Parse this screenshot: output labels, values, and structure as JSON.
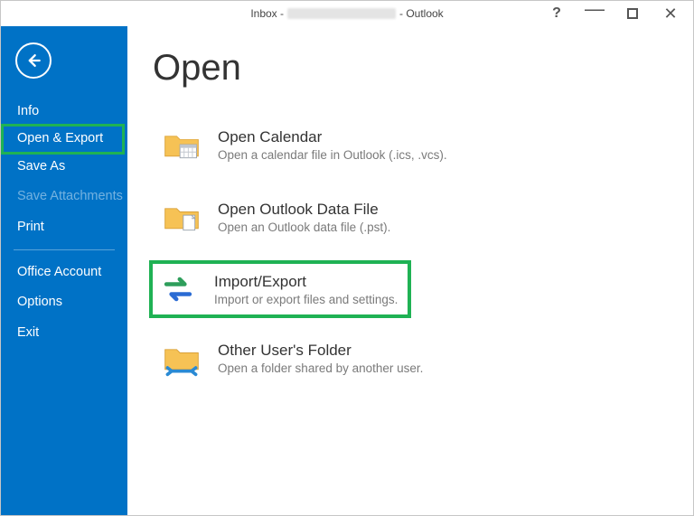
{
  "titlebar": {
    "prefix": "Inbox -",
    "suffix": "- Outlook"
  },
  "sidebar": {
    "items": [
      {
        "label": "Info"
      },
      {
        "label": "Open & Export"
      },
      {
        "label": "Save As"
      },
      {
        "label": "Save Attachments"
      },
      {
        "label": "Print"
      }
    ],
    "items2": [
      {
        "label": "Office Account"
      },
      {
        "label": "Options"
      },
      {
        "label": "Exit"
      }
    ]
  },
  "page": {
    "title": "Open"
  },
  "options": {
    "calendar": {
      "title": "Open Calendar",
      "desc": "Open a calendar file in Outlook (.ics, .vcs)."
    },
    "datafile": {
      "title": "Open Outlook Data File",
      "desc": "Open an Outlook data file (.pst)."
    },
    "importexport": {
      "title": "Import/Export",
      "desc": "Import or export files and settings."
    },
    "otheruser": {
      "title": "Other User's Folder",
      "desc": "Open a folder shared by another user."
    }
  }
}
